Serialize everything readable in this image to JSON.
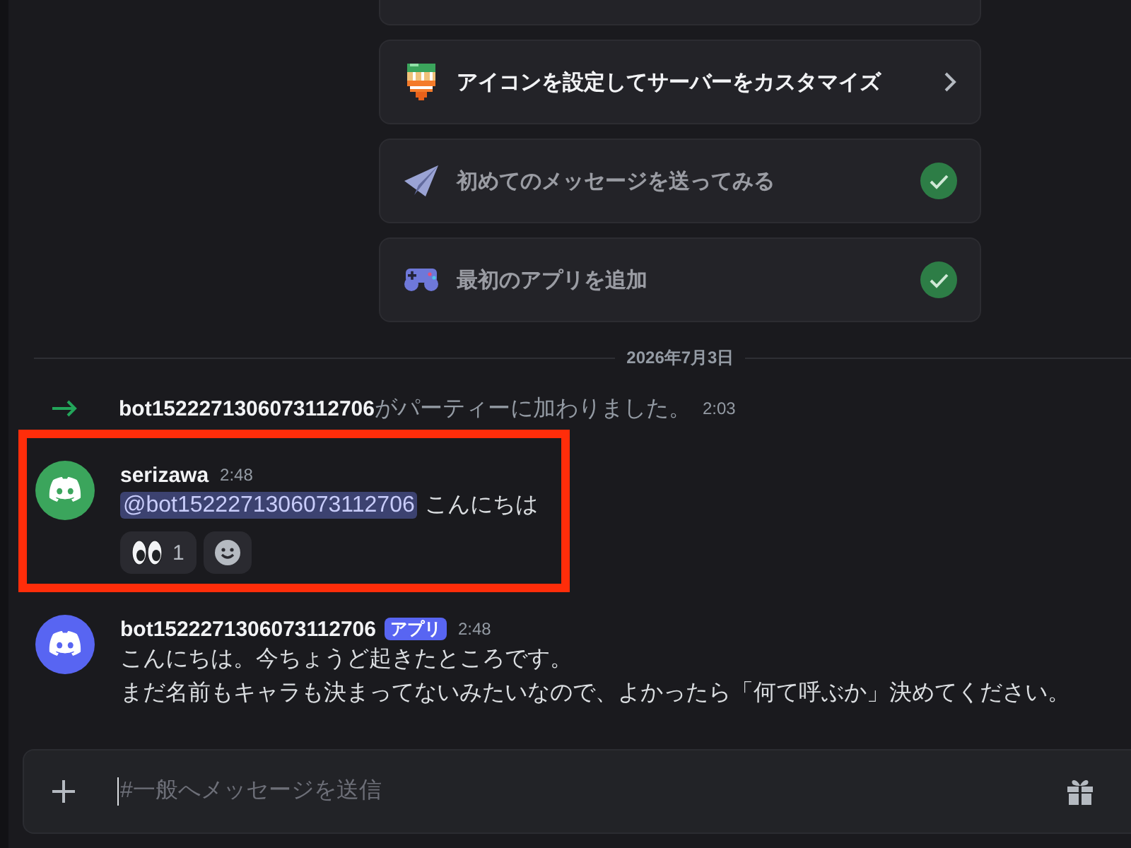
{
  "checklist": [
    {
      "label": "アイコンを設定してサーバーをカスタマイズ",
      "done": false
    },
    {
      "label": "初めてのメッセージを送ってみる",
      "done": true
    },
    {
      "label": "最初のアプリを追加",
      "done": true
    }
  ],
  "date_divider": "2026年7月3日",
  "system_message": {
    "user": "bot1522271306073112706",
    "text": "がパーティーに加わりました。",
    "time": "2:03"
  },
  "messages": [
    {
      "author": "serizawa",
      "time": "2:48",
      "color": "#3ba55c",
      "highlighted": true,
      "lines": [
        [
          {
            "kind": "mention",
            "text": "@bot1522271306073112706"
          },
          {
            "kind": "text",
            "text": "こんにちは"
          }
        ]
      ],
      "reactions": [
        {
          "count": "1",
          "selected": false
        }
      ]
    },
    {
      "author": "bot1522271306073112706",
      "badge": "アプリ",
      "time": "2:48",
      "color": "#5865f2",
      "highlighted": false,
      "lines": [
        [
          {
            "kind": "text",
            "text": "こんにちは。今ちょうど起きたところです。"
          }
        ],
        [
          {
            "kind": "text",
            "text": "まだ名前もキャラも決まってないみたいなので、よかったら「何て呼ぶか」決めてください。"
          }
        ]
      ]
    }
  ],
  "composer": {
    "placeholder": "#一般へメッセージを送信"
  }
}
